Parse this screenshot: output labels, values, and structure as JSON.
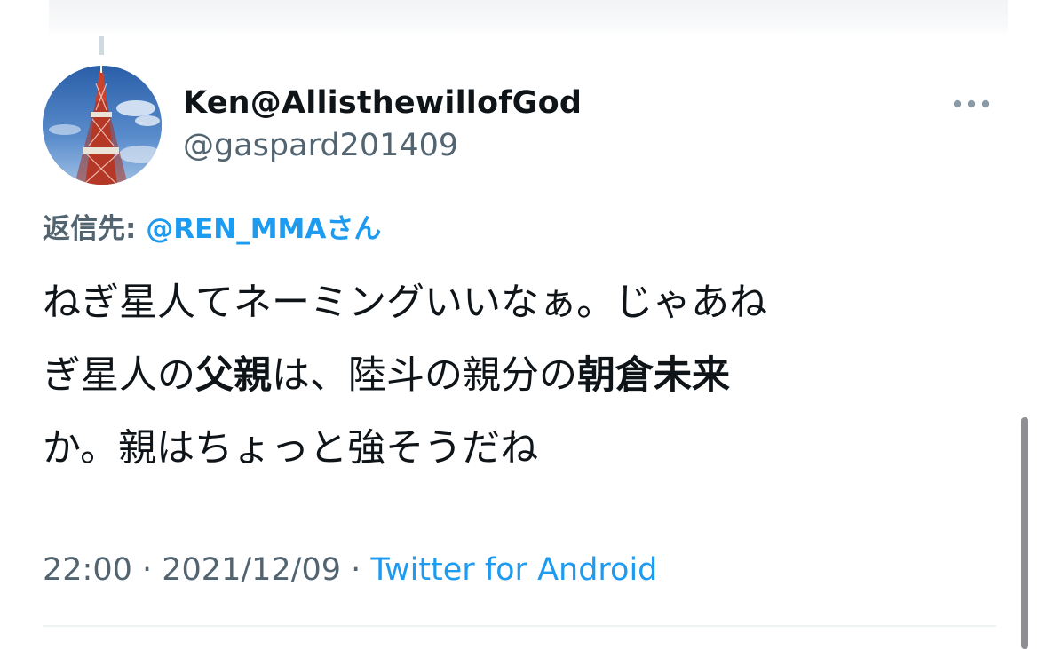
{
  "user": {
    "display_name": "Ken@AllisthewillofGod",
    "handle": "@gaspard201409",
    "avatar_icon": "tokyo-tower-photo"
  },
  "reply": {
    "prefix": "返信先: ",
    "mention": "@REN_MMAさん"
  },
  "tweet": {
    "line1": "ねぎ星人てネーミングいいなぁ。じゃあね",
    "line2_a": "ぎ星人の",
    "line2_b": "父親",
    "line2_c": "は、陸斗の親分の",
    "line2_d": "朝倉未来",
    "line3": "か。親はちょっと強そうだね"
  },
  "meta": {
    "time": "22:00",
    "separator1": " · ",
    "date": "2021/12/09",
    "separator2": " · ",
    "source": "Twitter for Android"
  },
  "icons": {
    "more": "more-horizontal-icon"
  },
  "colors": {
    "link": "#1d9bf0",
    "secondary": "#536471",
    "text": "#0f1419"
  }
}
